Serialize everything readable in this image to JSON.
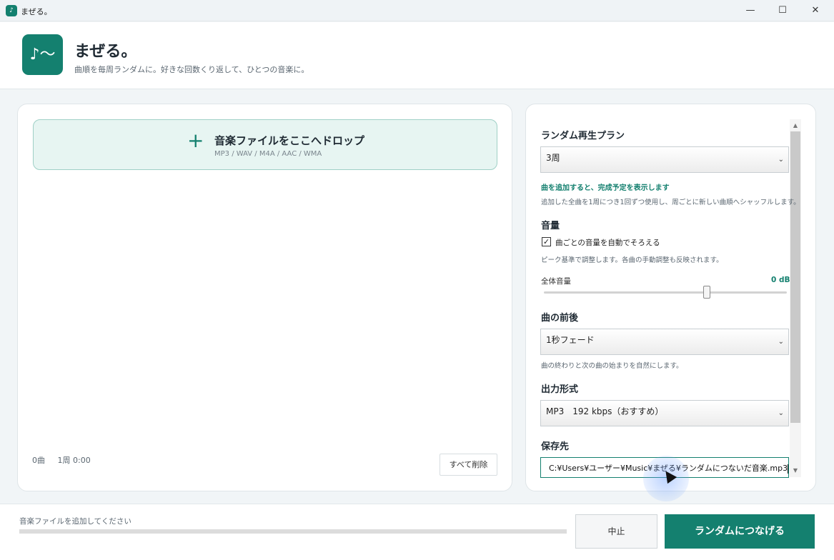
{
  "window": {
    "title": "まぜる。",
    "minimize": "—",
    "maximize": "☐",
    "close": "✕"
  },
  "header": {
    "logo_glyph": "♪～",
    "title": "まぜる。",
    "subtitle": "曲順を毎周ランダムに。好きな回数くり返して、ひとつの音楽に。"
  },
  "dropzone": {
    "plus": "+",
    "title": "音楽ファイルをここへドロップ",
    "formats": "MP3 / WAV / M4A / AAC / WMA"
  },
  "left_status": {
    "track_count": "0曲",
    "loop_duration": "1周 0:00",
    "clear_all": "すべて削除"
  },
  "settings": {
    "plan": {
      "title": "ランダム再生プラン",
      "selected": "3周",
      "note_highlight": "曲を追加すると、完成予定を表示します",
      "note": "追加した全曲を1周につき1回ずつ使用し、周ごとに新しい曲順へシャッフルします。"
    },
    "volume": {
      "title": "音量",
      "auto_label": "曲ごとの音量を自動でそろえる",
      "auto_checked": true,
      "check_glyph": "✓",
      "note": "ピーク基準で調整します。各曲の手動調整も反映されます。",
      "master_label": "全体音量",
      "master_value": "0 dB",
      "master_level_fraction": 0.67
    },
    "transition": {
      "title": "曲の前後",
      "selected": "1秒フェード",
      "note": "曲の終わりと次の曲の始まりを自然にします。"
    },
    "format": {
      "title": "出力形式",
      "selected": "MP3　192 kbps（おすすめ）"
    },
    "save": {
      "title": "保存先",
      "path": "C:¥Users¥ユーザー¥Music¥まぜる¥ランダムにつないだ音楽.mp3"
    },
    "arrow_glyph": "⌄"
  },
  "bottom": {
    "status": "音楽ファイルを追加してください",
    "progress_fraction": 0,
    "stop": "中止",
    "go": "ランダムにつなげる"
  },
  "colors": {
    "accent": "#14806f",
    "accent_light": "#e7f5f2"
  },
  "icons": {
    "app": "music-note-icon",
    "add": "plus-icon",
    "dropdown": "chevron-down-icon"
  }
}
